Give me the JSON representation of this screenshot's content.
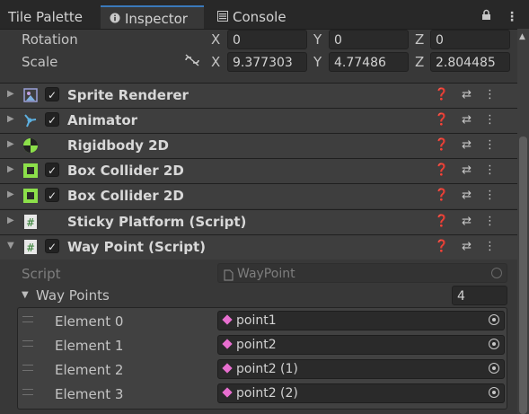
{
  "tabs": [
    {
      "label": "Tile Palette",
      "icon": ""
    },
    {
      "label": "Inspector",
      "icon": "info-icon"
    },
    {
      "label": "Console",
      "icon": "console-icon"
    }
  ],
  "transform": {
    "rotation": {
      "label": "Rotation",
      "x": "0",
      "y": "0",
      "z": "0"
    },
    "scale": {
      "label": "Scale",
      "x": "9.377303",
      "y": "4.77486",
      "z": "2.804485"
    },
    "axes": {
      "x": "X",
      "y": "Y",
      "z": "Z"
    }
  },
  "components": [
    {
      "name": "Sprite Renderer",
      "icon": "sprite-renderer-icon",
      "checkbox": true
    },
    {
      "name": "Animator",
      "icon": "animator-icon",
      "checkbox": true
    },
    {
      "name": "Rigidbody 2D",
      "icon": "rigidbody-icon",
      "checkbox": false
    },
    {
      "name": "Box Collider 2D",
      "icon": "box-collider-icon",
      "checkbox": true
    },
    {
      "name": "Box Collider 2D",
      "icon": "box-collider-icon",
      "checkbox": true
    },
    {
      "name": "Sticky Platform (Script)",
      "icon": "script-icon",
      "checkbox": false
    },
    {
      "name": "Way Point (Script)",
      "icon": "script-icon",
      "checkbox": true
    }
  ],
  "waypoint": {
    "script_label": "Script",
    "script_value": "WayPoint",
    "list_label": "Way Points",
    "list_size": "4",
    "elements": [
      {
        "label": "Element 0",
        "value": "point1"
      },
      {
        "label": "Element 1",
        "value": "point2"
      },
      {
        "label": "Element 2",
        "value": "point2 (1)"
      },
      {
        "label": "Element 3",
        "value": "point2 (2)"
      }
    ]
  },
  "colors": {
    "accent": "#3a79bb",
    "gameobject_icon": "#e86fd0",
    "collider_green": "#8ce04a"
  }
}
